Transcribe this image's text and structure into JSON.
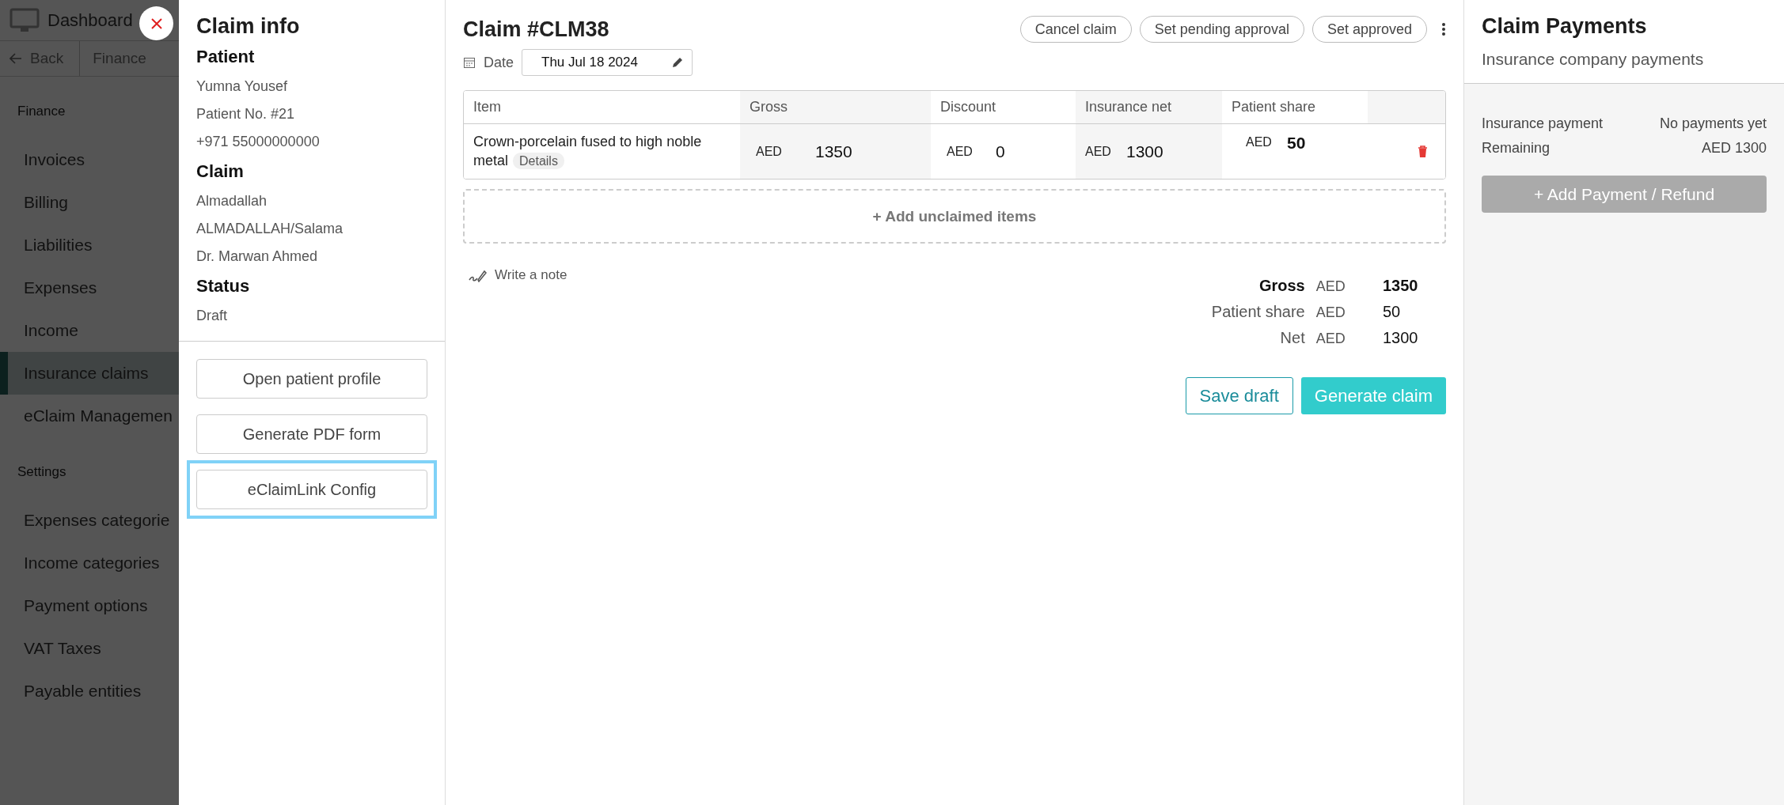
{
  "background_app": {
    "brand": "Dashboard",
    "breadcrumb": {
      "back": "Back",
      "current": "Finance"
    },
    "sections": [
      {
        "title": "Finance",
        "items": [
          {
            "label": "Invoices",
            "selected": false
          },
          {
            "label": "Billing",
            "selected": false
          },
          {
            "label": "Liabilities",
            "selected": false
          },
          {
            "label": "Expenses",
            "selected": false
          },
          {
            "label": "Income",
            "selected": false
          },
          {
            "label": "Insurance claims",
            "selected": true
          },
          {
            "label": "eClaim Managemen",
            "selected": false
          }
        ]
      },
      {
        "title": "Settings",
        "items": [
          {
            "label": "Expenses categorie",
            "selected": false
          },
          {
            "label": "Income categories",
            "selected": false
          },
          {
            "label": "Payment options",
            "selected": false
          },
          {
            "label": "VAT Taxes",
            "selected": false
          },
          {
            "label": "Payable entities",
            "selected": false
          }
        ]
      }
    ]
  },
  "claim_info": {
    "title": "Claim info",
    "groups": [
      {
        "heading": "Patient",
        "lines": [
          "Yumna Yousef",
          "Patient No. #21",
          "+971 55000000000"
        ]
      },
      {
        "heading": "Claim",
        "lines": [
          "Almadallah",
          "ALMADALLAH/Salama",
          "Dr. Marwan Ahmed"
        ]
      },
      {
        "heading": "Status",
        "lines": [
          "Draft"
        ]
      }
    ],
    "buttons": [
      {
        "label": "Open patient profile",
        "focused": false
      },
      {
        "label": "Generate PDF form",
        "focused": false
      },
      {
        "label": "eClaimLink Config",
        "focused": true
      }
    ]
  },
  "claim": {
    "title": "Claim #CLM38",
    "actions": [
      "Cancel claim",
      "Set pending approval",
      "Set approved"
    ],
    "date": {
      "label": "Date",
      "value": "Thu Jul 18 2024"
    },
    "table": {
      "columns": [
        "Item",
        "Gross",
        "Discount",
        "Insurance net",
        "Patient share"
      ],
      "rows": [
        {
          "cells": [
            {
              "kind": "item",
              "text": "Crown-porcelain fused to high noble metal",
              "details": "Details"
            },
            {
              "kind": "money",
              "currency": "AED",
              "amount": "1350",
              "bold": false
            },
            {
              "kind": "money",
              "currency": "AED",
              "amount": "0",
              "bold": false
            },
            {
              "kind": "money",
              "currency": "AED",
              "amount": "1300",
              "bold": false
            },
            {
              "kind": "money",
              "currency": "AED",
              "amount": "50",
              "bold": true
            }
          ]
        }
      ]
    },
    "add_items": "+ Add unclaimed items",
    "note": "Write a note",
    "totals": [
      {
        "label": "Gross",
        "currency": "AED",
        "amount": "1350",
        "bold": true
      },
      {
        "label": "Patient share",
        "currency": "AED",
        "amount": "50",
        "bold": false
      },
      {
        "label": "Net",
        "currency": "AED",
        "amount": "1300",
        "bold": false
      }
    ],
    "save": "Save draft",
    "generate": "Generate claim"
  },
  "payments": {
    "title": "Claim Payments",
    "subtitle": "Insurance company payments",
    "rows": [
      {
        "label": "Insurance payment",
        "value": "No payments yet"
      },
      {
        "label": "Remaining",
        "value": "AED 1300"
      }
    ],
    "button": {
      "label": "+ Add Payment / Refund",
      "disabled": true
    }
  }
}
